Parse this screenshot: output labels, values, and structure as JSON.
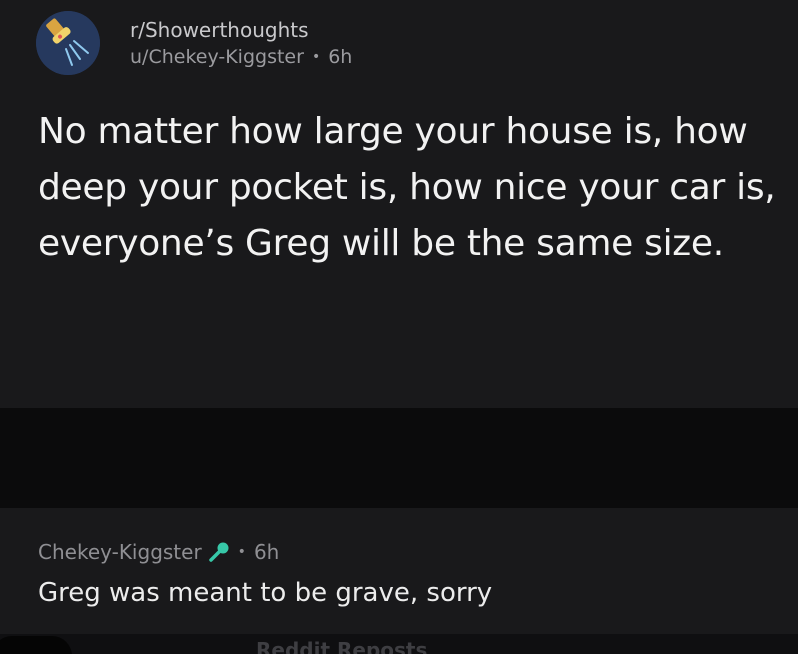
{
  "post": {
    "subreddit": "r/Showerthoughts",
    "author": "u/Chekey-Kiggster",
    "separator": "•",
    "age": "6h",
    "title": "No matter how large your house is, how deep your pocket is, how nice your car is, everyone’s Greg will be the same size.",
    "avatar_icon": "shower-head-icon"
  },
  "comment": {
    "author": "Chekey-Kiggster",
    "flair_icon": "microphone-icon",
    "separator": "•",
    "age": "6h",
    "body": "Greg was meant to be grave, sorry"
  },
  "footer": {
    "text": "Reddit Reposts"
  },
  "colors": {
    "background": "#0e0e10",
    "card": "#19191b",
    "avatar_bg": "#26395e",
    "flair": "#37c8a8"
  }
}
